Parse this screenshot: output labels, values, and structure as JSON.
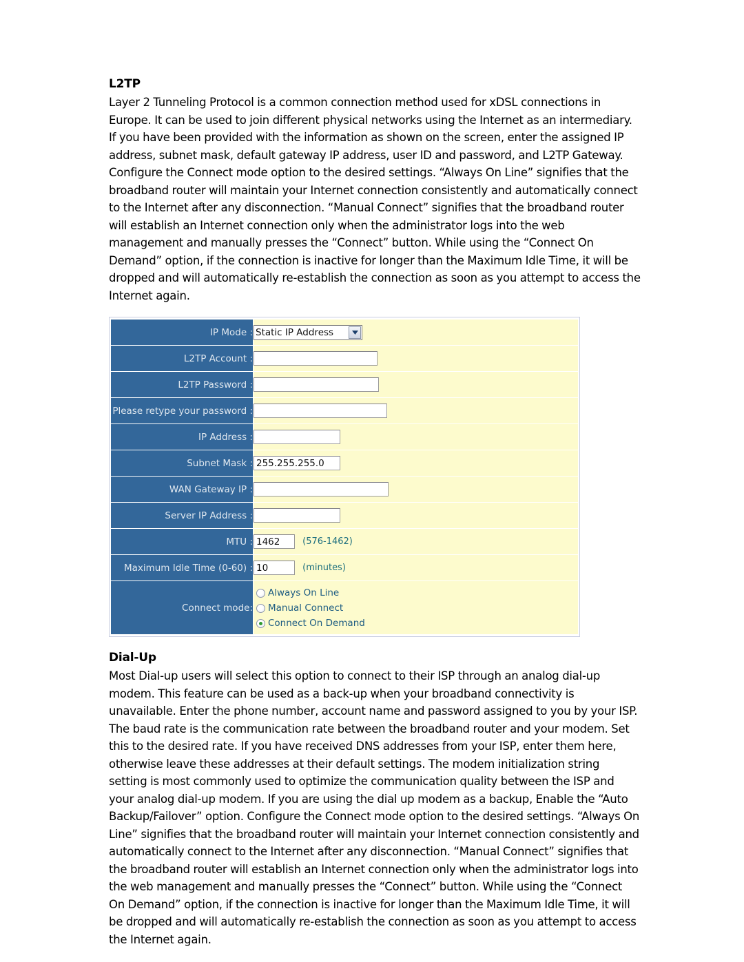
{
  "document": {
    "sections": [
      {
        "heading": "L2TP",
        "paragraph": "Layer 2 Tunneling Protocol is a common connection method used for xDSL connections in Europe. It can be used to join different physical networks using the Internet as an intermediary. If you have been provided with the information as shown on the screen, enter the assigned IP address, subnet mask, default gateway IP address, user ID and password, and L2TP Gateway. Configure the Connect mode option to the desired settings. “Always On Line” signifies that the broadband router will maintain your Internet connection consistently and automatically connect to the Internet after any disconnection. “Manual Connect” signifies that the broadband router will establish an Internet connection only when the administrator logs into the web management and manually presses the “Connect” button. While using the “Connect On Demand” option, if the connection is inactive for longer than the Maximum Idle Time, it will be dropped and will automatically re-establish the connection as soon as you attempt to access the Internet again."
      },
      {
        "heading": "Dial-Up",
        "paragraph": "Most Dial-up users will select this option to connect to their ISP through an analog dial-up modem. This feature can be used as a back-up when your broadband connectivity is unavailable. Enter the phone number, account name and password assigned to you by your ISP. The baud rate is the communication rate between the broadband router and your modem. Set this to the desired rate. If you have received DNS addresses from your ISP, enter them here, otherwise leave these addresses at their default settings. The modem initialization string setting is most commonly used to optimize the communication quality between the ISP and your analog dial-up modem. If you are using the dial up modem as a backup, Enable the “Auto Backup/Failover” option. Configure the Connect mode option to the desired settings. “Always On Line” signifies that the broadband router will maintain your Internet connection consistently and automatically connect to the Internet after any disconnection. “Manual Connect” signifies that the broadband router will establish an Internet connection only when the administrator logs into the web management and manually presses the “Connect” button. While using the “Connect On Demand” option, if the connection is inactive for longer than the Maximum Idle Time, it will be dropped and will automatically re-establish the connection as soon as you attempt to access the Internet again."
      }
    ]
  },
  "colors": {
    "label_bg": "#33679a",
    "label_text": "#dfe7ef",
    "field_bg": "#fdfbcd",
    "hint_text": "#1d6f7e",
    "radio_label_text": "#1d5c82",
    "radio_selected_dot": "#2f9a2f",
    "table_border": "#c8cde0"
  },
  "config_form": {
    "rows": [
      {
        "label": "IP Mode :",
        "control": "select",
        "value": "Static IP Address",
        "hint": ""
      },
      {
        "label": "L2TP Account :",
        "control": "text",
        "value": "",
        "hint": ""
      },
      {
        "label": "L2TP Password :",
        "control": "password",
        "value": "",
        "hint": ""
      },
      {
        "label": "Please retype your password :",
        "control": "password",
        "value": "",
        "hint": ""
      },
      {
        "label": "IP Address :",
        "control": "text",
        "value": "",
        "hint": ""
      },
      {
        "label": "Subnet Mask :",
        "control": "text",
        "value": "255.255.255.0",
        "hint": ""
      },
      {
        "label": "WAN Gateway IP :",
        "control": "text",
        "value": "",
        "hint": ""
      },
      {
        "label": "Server IP Address :",
        "control": "text",
        "value": "",
        "hint": ""
      },
      {
        "label": "MTU :",
        "control": "text",
        "value": "1462",
        "hint": "(576-1462)"
      },
      {
        "label": "Maximum Idle Time (0-60) :",
        "control": "text",
        "value": "10",
        "hint": "(minutes)"
      },
      {
        "label": "Connect mode:",
        "control": "radio",
        "value": "Connect On Demand",
        "hint": ""
      }
    ],
    "ip_mode_selected": "Static IP Address",
    "l2tp_account": "",
    "l2tp_password": "",
    "retype_password": "",
    "ip_address": "",
    "subnet_mask": "255.255.255.0",
    "wan_gateway_ip": "",
    "server_ip_address": "",
    "mtu": "1462",
    "mtu_hint": "(576-1462)",
    "max_idle_time": "10",
    "max_idle_hint": "(minutes)",
    "connect_mode_options": [
      {
        "label": "Always On Line",
        "selected": false
      },
      {
        "label": "Manual Connect",
        "selected": false
      },
      {
        "label": "Connect On Demand",
        "selected": true
      }
    ],
    "labels": {
      "ip_mode": "IP Mode :",
      "l2tp_account": "L2TP Account :",
      "l2tp_password": "L2TP Password :",
      "retype_password": "Please retype your password :",
      "ip_address": "IP Address :",
      "subnet_mask": "Subnet Mask :",
      "wan_gateway_ip": "WAN Gateway IP :",
      "server_ip_address": "Server IP Address :",
      "mtu": "MTU :",
      "max_idle_time": "Maximum Idle Time (0-60) :",
      "connect_mode": "Connect mode:"
    }
  }
}
